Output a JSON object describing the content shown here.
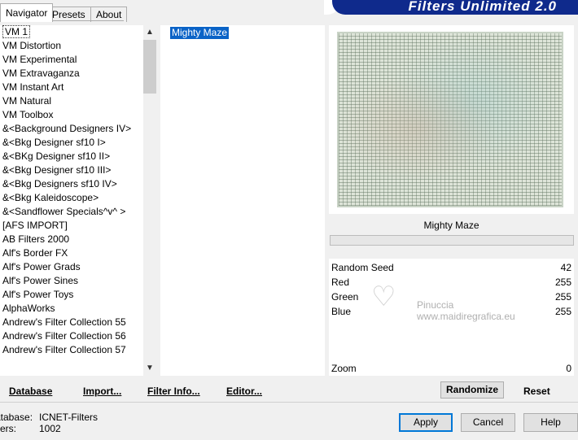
{
  "tabs": [
    {
      "label": "Navigator",
      "active": true
    },
    {
      "label": "Presets",
      "active": false
    },
    {
      "label": "About",
      "active": false
    }
  ],
  "banner": {
    "title": "Filters Unlimited 2.0"
  },
  "categories": [
    "VM 1",
    "VM Distortion",
    "VM Experimental",
    "VM Extravaganza",
    "VM Instant Art",
    "VM Natural",
    "VM Toolbox",
    "&<Background Designers IV>",
    "&<Bkg Designer sf10 I>",
    "&<BKg Designer sf10 II>",
    "&<Bkg Designer sf10 III>",
    "&<Bkg Designers sf10 IV>",
    "&<Bkg Kaleidoscope>",
    "&<Sandflower Specials^v^ >",
    "[AFS IMPORT]",
    "AB Filters 2000",
    "Alf's Border FX",
    "Alf's Power Grads",
    "Alf's Power Sines",
    "Alf's Power Toys",
    "AlphaWorks",
    "Andrew's Filter Collection 55",
    "Andrew's Filter Collection 56",
    "Andrew's Filter Collection 57"
  ],
  "selected_category": "VM 1",
  "filters": [
    "Mighty Maze"
  ],
  "preview": {
    "filter_name": "Mighty Maze"
  },
  "params": [
    {
      "label": "Random Seed",
      "value": "42"
    },
    {
      "label": "Red",
      "value": "255"
    },
    {
      "label": "Green",
      "value": "255"
    },
    {
      "label": "Blue",
      "value": "255"
    }
  ],
  "zoom": {
    "label": "Zoom",
    "value": "0"
  },
  "watermark": {
    "line1": "Pinuccia",
    "line2": "www.maidiregrafica.eu"
  },
  "links": {
    "database": "Database",
    "import": "Import...",
    "filter_info": "Filter Info...",
    "editor": "Editor..."
  },
  "actions": {
    "randomize": "Randomize",
    "reset": "Reset"
  },
  "info": {
    "db_label": "atabase:",
    "db_value": "ICNET-Filters",
    "filters_label": "lters:",
    "filters_value": "1002"
  },
  "buttons": {
    "apply": "Apply",
    "cancel": "Cancel",
    "help": "Help"
  },
  "colors": {
    "banner": "#0f2a8c",
    "selection": "#0a63c7",
    "focus": "#0078d7"
  }
}
